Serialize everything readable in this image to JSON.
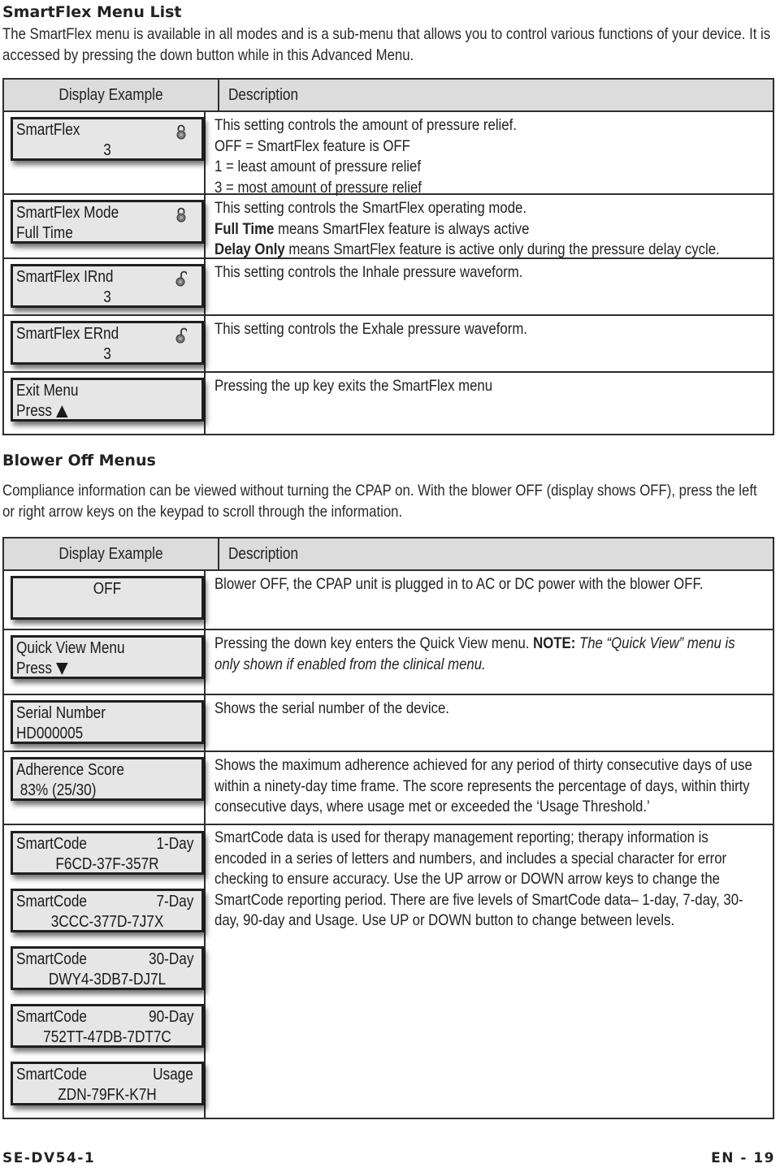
{
  "smartflex_section": {
    "title": "SmartFlex Menu List",
    "intro": "The SmartFlex menu is available in all modes and is a sub-menu that allows you to control various functions of your device. It is accessed by pressing the down button while in this Advanced Menu.",
    "table": {
      "col_display": "Display Example",
      "col_description": "Description",
      "rows": [
        {
          "display_line1": "SmartFlex",
          "display_line2": "3",
          "icon": "lock-closed-icon",
          "description": [
            "This setting controls the amount of pressure relief.",
            "OFF = SmartFlex feature is OFF",
            "1 = least amount of pressure relief",
            "3 =  most amount of pressure relief"
          ]
        },
        {
          "display_line1": "SmartFlex Mode",
          "display_line2": "Full Time",
          "icon": "lock-closed-icon",
          "description_intro": "This setting controls the SmartFlex operating mode.",
          "description_items": [
            {
              "bold": "Full Time",
              "text": " means SmartFlex feature is always active"
            },
            {
              "bold": "Delay Only",
              "text": " means SmartFlex feature is active only during the pressure delay cycle."
            }
          ]
        },
        {
          "display_line1": "SmartFlex IRnd",
          "display_line2": "3",
          "icon": "lock-open-icon",
          "description": [
            "This setting controls the Inhale pressure waveform."
          ]
        },
        {
          "display_line1": "SmartFlex ERnd",
          "display_line2": "3",
          "icon": "lock-open-icon",
          "description": [
            "This setting controls the Exhale pressure waveform."
          ]
        },
        {
          "display_line1": "Exit Menu",
          "display_line2": "Press",
          "icon": "up-arrow-icon",
          "description": [
            "Pressing the up key exits the SmartFlex menu"
          ]
        }
      ]
    }
  },
  "blower_section": {
    "title": "Blower Off Menus",
    "intro": "Compliance information can be viewed without turning the CPAP on. With the blower OFF (display shows OFF), press the left or right arrow keys on the keypad to scroll through the information.",
    "table": {
      "col_display": "Display Example",
      "col_description": "Description",
      "rows": [
        {
          "display_line1": "OFF",
          "description": "Blower OFF, the CPAP unit is plugged in to AC or DC power with the blower OFF."
        },
        {
          "display_line1": "Quick View Menu",
          "display_line2": "Press",
          "icon": "down-arrow-icon",
          "description_text": "Pressing the down key enters the Quick View menu. ",
          "description_note_label": "NOTE:",
          "description_note": " The “Quick View” menu is only shown if enabled from the clinical menu."
        },
        {
          "display_line1": "Serial Number",
          "display_line2": "HD000005",
          "description": "Shows the serial number of the device."
        },
        {
          "display_line1": "Adherence Score",
          "display_line2": " 83% (25/30)",
          "description": "Shows the maximum adherence achieved for any period of thirty consecutive days of use within a ninety-day time frame. The score represents the percentage of days, within thirty consecutive days, where usage met or exceeded the ‘Usage Threshold.’"
        }
      ],
      "smartcode_row": {
        "description": "SmartCode data is used for therapy management reporting; therapy information is encoded in a series of letters and numbers, and includes a special character for error checking to ensure accuracy. Use the UP arrow or DOWN arrow keys to change the SmartCode reporting period. There are five levels of SmartCode data– 1-day, 7-day, 30-day, 90-day and Usage. Use UP or DOWN button to change between levels.",
        "displays": [
          {
            "label": "SmartCode",
            "period": "1-Day",
            "code": "F6CD-37F-357R"
          },
          {
            "label": "SmartCode",
            "period": "7-Day",
            "code": "3CCC-377D-7J7X"
          },
          {
            "label": "SmartCode",
            "period": "30-Day",
            "code": "DWY4-3DB7-DJ7L"
          },
          {
            "label": "SmartCode",
            "period": "90-Day",
            "code": "752TT-47DB-7DT7C"
          },
          {
            "label": "SmartCode",
            "period": "Usage",
            "code": "ZDN-79FK-K7H"
          }
        ]
      }
    }
  },
  "footer": {
    "doc_code": "SE-DV54-1",
    "page": "EN - 19"
  }
}
